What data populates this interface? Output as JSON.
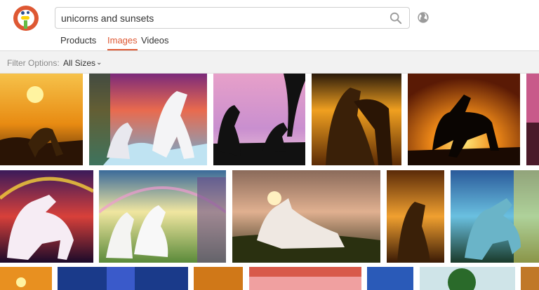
{
  "search": {
    "query": "unicorns and sunsets"
  },
  "tabs": [
    {
      "label": "Products",
      "active": false
    },
    {
      "label": "Images",
      "active": true
    },
    {
      "label": "Videos",
      "active": false
    }
  ],
  "filters": {
    "label": "Filter Options:",
    "size_value": "All Sizes"
  },
  "colors": {
    "accent": "#de5833"
  },
  "results_count_visible": 20
}
